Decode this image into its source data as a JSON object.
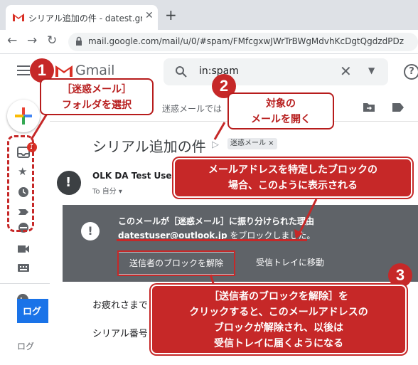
{
  "browser": {
    "tab_title": "シリアル追加の件 - datest.gm@gm",
    "url": "mail.google.com/mail/u/0/#spam/FMfcgxwJWrTrBWgMdvhKcDgtQgdzdPDz",
    "new_tab": "+"
  },
  "gmail": {
    "logo_text": "Gmail",
    "search_value": "in:spam",
    "toolbar_text": "迷惑メールでは"
  },
  "sidebar": {
    "badge_count": "1",
    "bottom_text": "ログ",
    "tile_text": "ログ"
  },
  "mail": {
    "subject": "シリアル追加の件",
    "spam_chip": "迷惑メール ×",
    "sender_name": "OLK DA Test User",
    "recipient": "To 自分 ▾",
    "banner_reason": "このメールが［迷惑メール］に振り分けられた理由",
    "banner_blocked_email": "datestuser@outlook.jp",
    "banner_blocked_suffix": " をブロックしました。",
    "unblock_button": "送信者のブロックを解除",
    "inbox_button": "受信トレイに移動",
    "body_line_1": "お疲れさまで",
    "body_line_2": "シリアル番号"
  },
  "annotations": {
    "step1_number": "1",
    "step1_text_line1": "［迷惑メール］",
    "step1_text_line2": "フォルダを選択",
    "step2_number": "2",
    "step2_text_line1": "対象の",
    "step2_text_line2": "メールを開く",
    "note_line1": "メールアドレスを特定したブロックの",
    "note_line2": "場合、このように表示される",
    "step3_number": "3",
    "step3_line1": "［送信者のブロックを解除］を",
    "step3_line2": "クリックすると、このメールアドレスの",
    "step3_line3": "ブロックが解除され、以後は",
    "step3_line4": "受信トレイに届くようになる"
  },
  "colors": {
    "annotation_red": "#c62828",
    "banner_gray": "#5f6368",
    "gmail_red": "#d93025"
  }
}
